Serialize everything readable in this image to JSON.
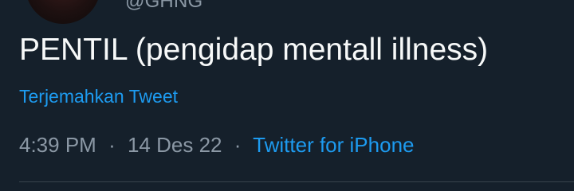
{
  "tweet": {
    "handle": "@GHNG",
    "text": "PENTIL (pengidap mentall illness)",
    "translate_label": "Terjemahkan Tweet",
    "time": "4:39 PM",
    "separator_1": "·",
    "date": "14 Des 22",
    "separator_2": "·",
    "source": "Twitter for iPhone"
  },
  "colors": {
    "background": "#15202b",
    "text_primary": "#f7f9f9",
    "text_secondary": "#8b98a5",
    "link": "#1d9bf0",
    "divider": "#38444d"
  }
}
